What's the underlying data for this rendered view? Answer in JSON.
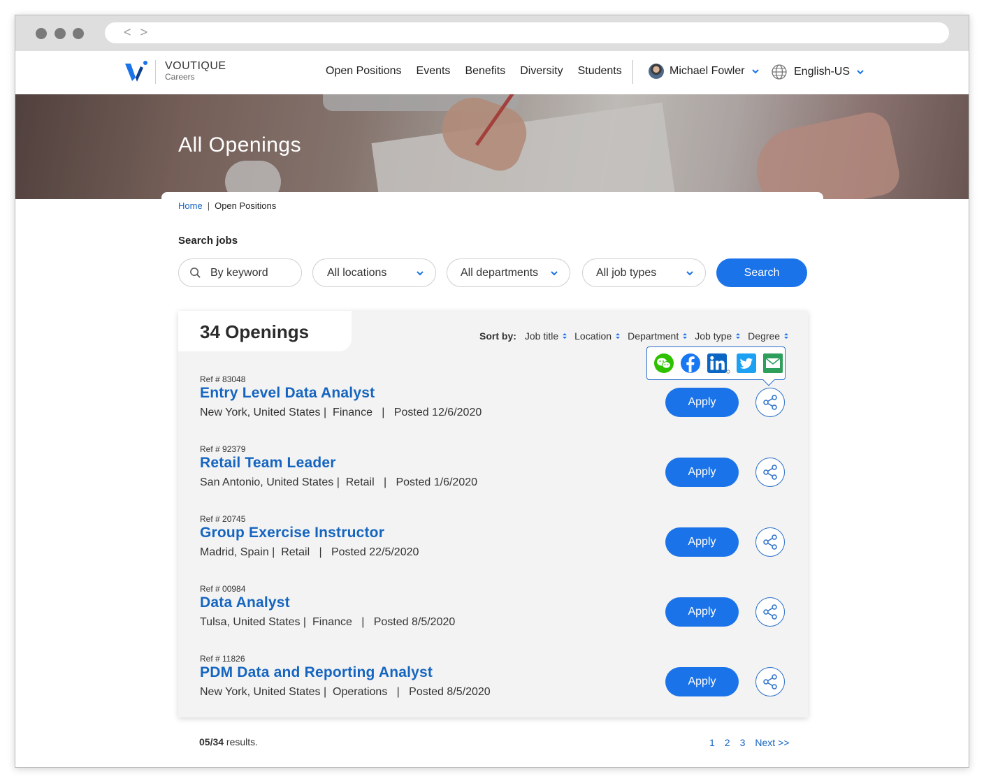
{
  "browser": {
    "nav_arrows": "< >"
  },
  "header": {
    "brand_name": "VOUTIQUE",
    "brand_sub": "Careers",
    "nav": [
      "Open Positions",
      "Events",
      "Benefits",
      "Diversity",
      "Students"
    ],
    "user_name": "Michael Fowler",
    "language": "English-US",
    "accent_color": "#1a73e8"
  },
  "hero": {
    "title": "All Openings"
  },
  "breadcrumb": {
    "home": "Home",
    "separator": "|",
    "current": "Open Positions"
  },
  "search": {
    "label": "Search jobs",
    "keyword_placeholder": "By keyword",
    "location": "All locations",
    "department": "All departments",
    "job_type": "All job types",
    "button": "Search"
  },
  "results": {
    "count_text": "34 Openings",
    "sort_label": "Sort by:",
    "sort_options": [
      "Job title",
      "Location",
      "Department",
      "Job type",
      "Degree"
    ],
    "share_networks": [
      "wechat-icon",
      "facebook-icon",
      "linkedin-icon",
      "twitter-icon",
      "email-icon"
    ],
    "jobs": [
      {
        "ref": "Ref # 83048",
        "title": "Entry Level Data Analyst",
        "location": "New York, United States",
        "department": "Finance",
        "posted": "Posted 12/6/2020"
      },
      {
        "ref": "Ref # 92379",
        "title": "Retail Team Leader",
        "location": "San Antonio, United States",
        "department": "Retail",
        "posted": "Posted 1/6/2020"
      },
      {
        "ref": "Ref # 20745",
        "title": "Group Exercise Instructor",
        "location": "Madrid, Spain",
        "department": "Retail",
        "posted": "Posted 22/5/2020"
      },
      {
        "ref": "Ref # 00984",
        "title": "Data Analyst",
        "location": "Tulsa, United States",
        "department": "Finance",
        "posted": "Posted 8/5/2020"
      },
      {
        "ref": "Ref # 11826",
        "title": "PDM Data and Reporting Analyst",
        "location": "New York, United States",
        "department": "Operations",
        "posted": "Posted 8/5/2020"
      }
    ],
    "apply_label": "Apply"
  },
  "footer": {
    "shown": "05/34",
    "results_suffix": " results.",
    "pages": [
      "1",
      "2",
      "3"
    ],
    "next": "Next >>"
  }
}
